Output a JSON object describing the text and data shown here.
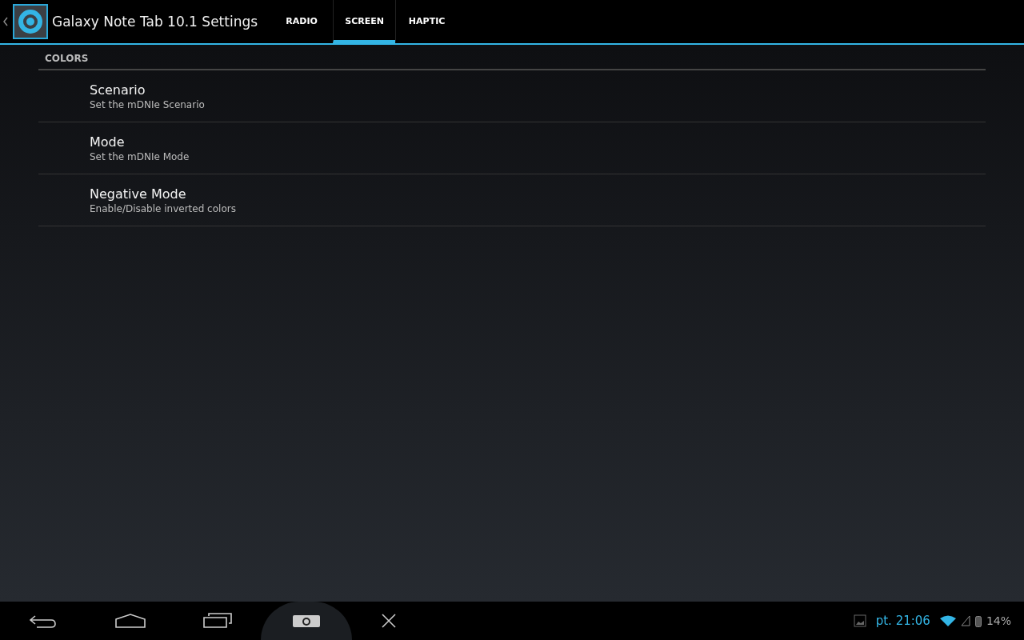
{
  "action_bar": {
    "title": "Galaxy Note Tab 10.1 Settings",
    "tabs": [
      {
        "label": "RADIO",
        "selected": false
      },
      {
        "label": "SCREEN",
        "selected": true
      },
      {
        "label": "HAPTIC",
        "selected": false
      }
    ]
  },
  "section": {
    "header": "COLORS",
    "items": [
      {
        "title": "Scenario",
        "summary": "Set the mDNIe Scenario"
      },
      {
        "title": "Mode",
        "summary": "Set the mDNIe Mode"
      },
      {
        "title": "Negative Mode",
        "summary": "Enable/Disable inverted colors"
      }
    ]
  },
  "status_bar": {
    "time": "pt. 21:06",
    "battery": "14%"
  }
}
